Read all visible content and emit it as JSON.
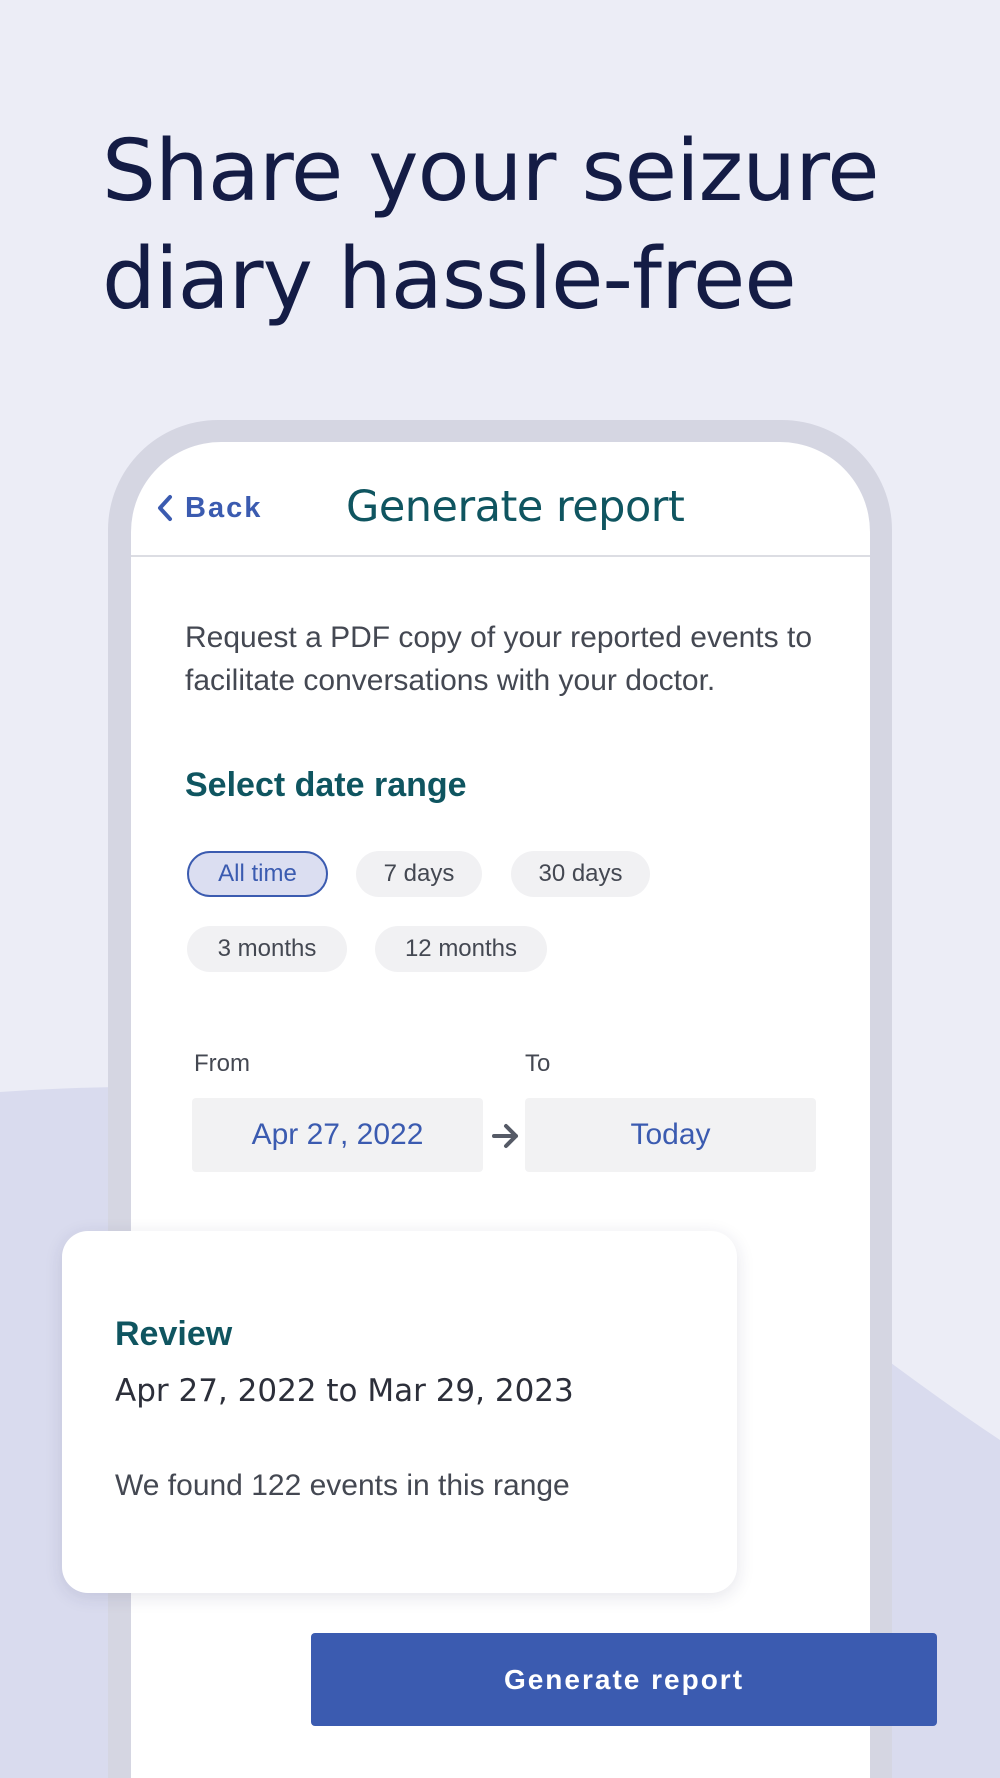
{
  "headline": {
    "line1": "Share your seizure",
    "line2": "diary hassle-free"
  },
  "screen": {
    "back_label": "Back",
    "title": "Generate report",
    "intro": "Request a PDF copy of your reported events to facilitate conversations with your doctor.",
    "date_range_title": "Select date range",
    "ranges": [
      {
        "label": "All time",
        "selected": true
      },
      {
        "label": "7 days",
        "selected": false
      },
      {
        "label": "30 days",
        "selected": false
      },
      {
        "label": "3 months",
        "selected": false
      },
      {
        "label": "12 months",
        "selected": false
      }
    ],
    "from_label": "From",
    "from_value": "Apr 27, 2022",
    "to_label": "To",
    "to_value": "Today"
  },
  "review": {
    "title": "Review",
    "range": "Apr 27, 2022 to Mar 29, 2023",
    "count_text": "We found 122 events in this range"
  },
  "action": {
    "generate_label": "Generate report"
  },
  "icons": {
    "back": "chevron-left-icon",
    "range_arrow": "arrow-right-icon"
  },
  "colors": {
    "background": "#ecedf6",
    "accent": "#3b5bb0",
    "teal_heading": "#0f5560",
    "headline": "#141c45"
  }
}
